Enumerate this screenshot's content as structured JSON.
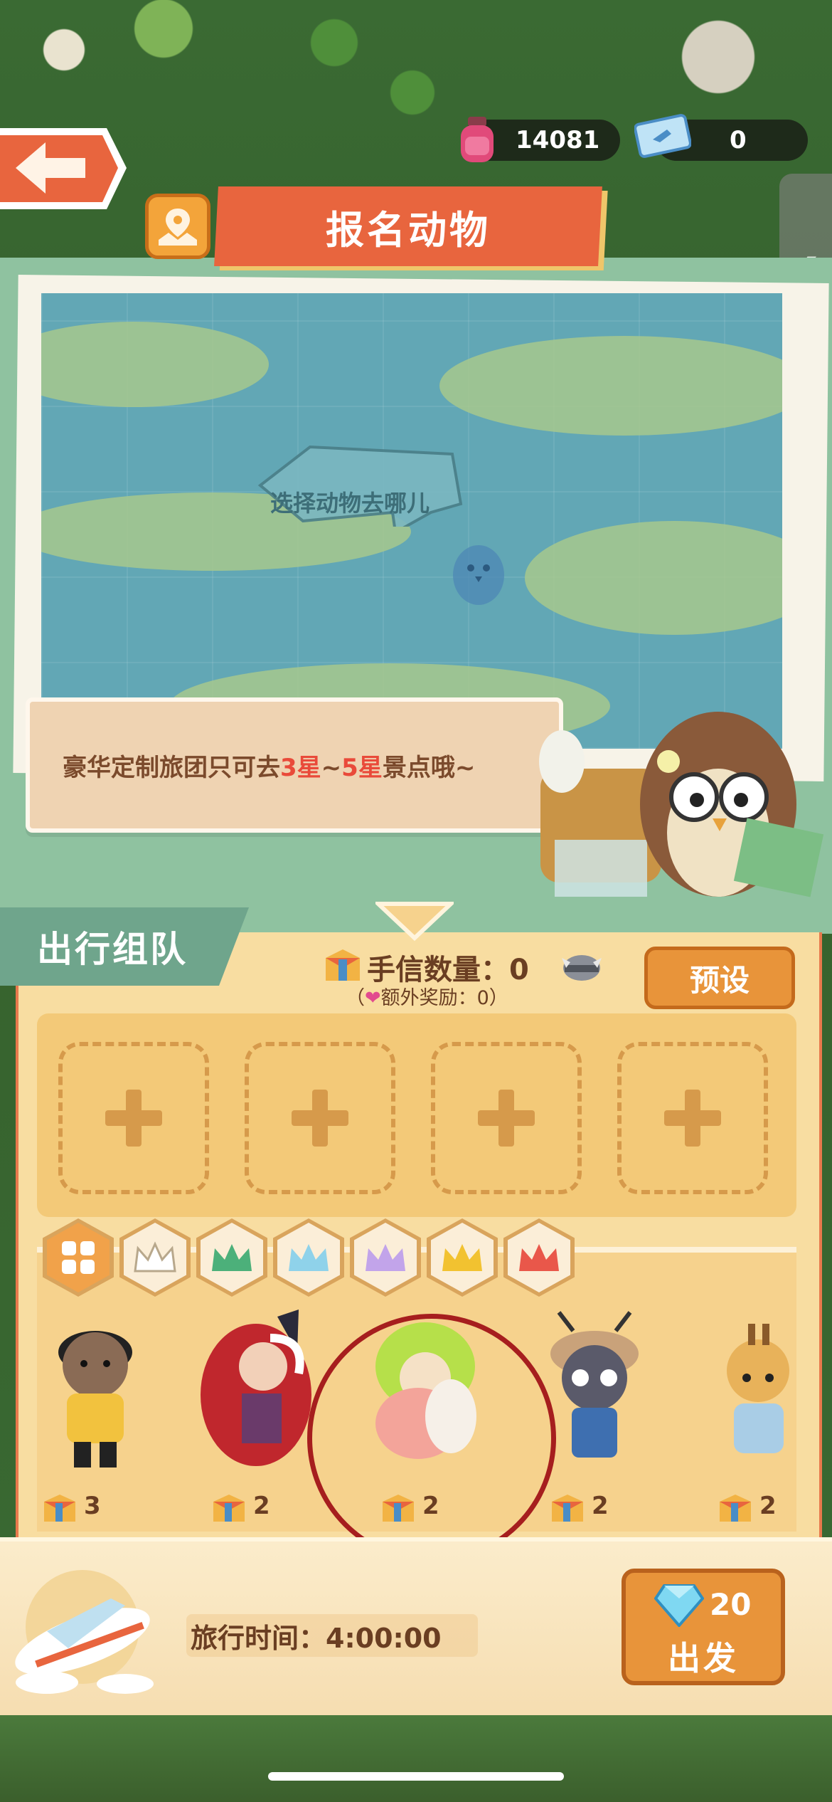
{
  "topbar": {
    "ink_amount": "14081",
    "ticket_amount": "0"
  },
  "banner": {
    "title": "报名动物"
  },
  "map": {
    "prompt": "选择动物去哪儿"
  },
  "hint": {
    "part1": "豪华定制旅团只可去",
    "highlight1": "3星",
    "sep": "~",
    "highlight2": "5星",
    "part2": "景点哦~"
  },
  "team": {
    "header": "出行组队",
    "letters_label": "手信数量：0",
    "extra_reward_prefix": "（",
    "extra_reward": "额外奖励：0）",
    "preset_label": "预设"
  },
  "slots": [
    "+",
    "+",
    "+",
    "+"
  ],
  "filters": [
    {
      "name": "all",
      "color": "#f1a24a"
    },
    {
      "name": "white-crown",
      "color": "#ffffff"
    },
    {
      "name": "green-crown",
      "color": "#4cb07a"
    },
    {
      "name": "blue-crown",
      "color": "#8fd2ea"
    },
    {
      "name": "purple-crown",
      "color": "#c2a4ea"
    },
    {
      "name": "gold-crown",
      "color": "#f2c230"
    },
    {
      "name": "red-crown",
      "color": "#e9574a"
    }
  ],
  "characters": [
    {
      "name": "bear",
      "count": "3"
    },
    {
      "name": "red-cat-girl",
      "count": "2"
    },
    {
      "name": "green-bird-girl",
      "count": "2"
    },
    {
      "name": "bug-explorer",
      "count": "2"
    },
    {
      "name": "giraffe",
      "count": "2"
    }
  ],
  "footer": {
    "travel_time": "旅行时间：4:00:00",
    "go_cost": "20",
    "go_label": "出发"
  },
  "colors": {
    "accent_orange": "#e8943a",
    "banner_red": "#e8653e",
    "team_green": "#6fa58c",
    "highlight_red": "#e94a3a"
  }
}
